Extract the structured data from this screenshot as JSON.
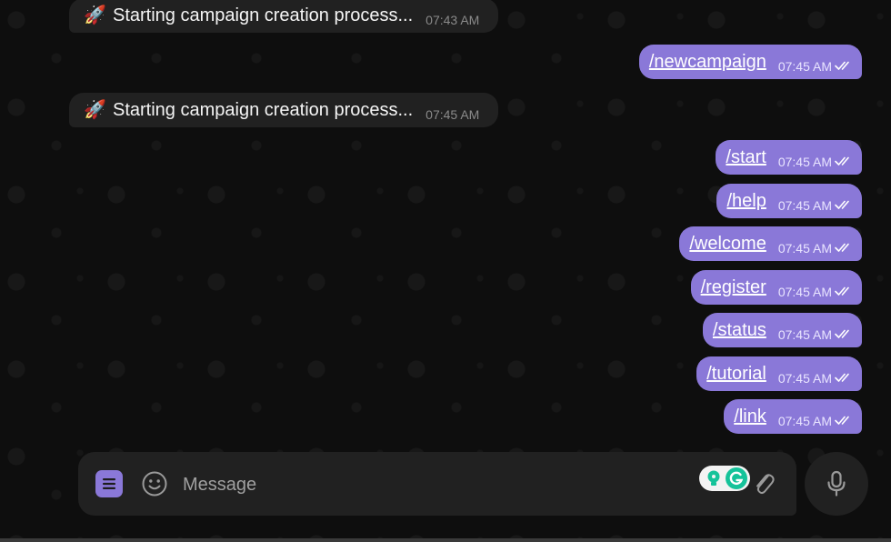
{
  "incoming": [
    {
      "icon": "rocket-icon",
      "emoji": "🚀",
      "text": "Starting campaign creation process...",
      "time": "07:43 AM"
    },
    {
      "icon": "rocket-icon",
      "emoji": "🚀",
      "text": "Starting campaign creation process...",
      "time": "07:45 AM"
    }
  ],
  "outgoing": [
    {
      "command": "/newcampaign",
      "time": "07:45 AM",
      "status": "read"
    },
    {
      "command": "/start",
      "time": "07:45 AM",
      "status": "read"
    },
    {
      "command": "/help",
      "time": "07:45 AM",
      "status": "read"
    },
    {
      "command": "/welcome",
      "time": "07:45 AM",
      "status": "read"
    },
    {
      "command": "/register",
      "time": "07:45 AM",
      "status": "read"
    },
    {
      "command": "/status",
      "time": "07:45 AM",
      "status": "read"
    },
    {
      "command": "/tutorial",
      "time": "07:45 AM",
      "status": "read"
    },
    {
      "command": "/link",
      "time": "07:45 AM",
      "status": "read"
    }
  ],
  "composer": {
    "placeholder": "Message",
    "icons": {
      "menu": "menu-icon",
      "emoji": "smiley-icon",
      "grammarly": "grammarly-icon",
      "attach": "paperclip-icon",
      "mic": "microphone-icon"
    }
  },
  "colors": {
    "accent": "#8a78d8",
    "bubble_in": "#212121",
    "background": "#0e0e0e",
    "grammarly_green": "#15c39a"
  }
}
